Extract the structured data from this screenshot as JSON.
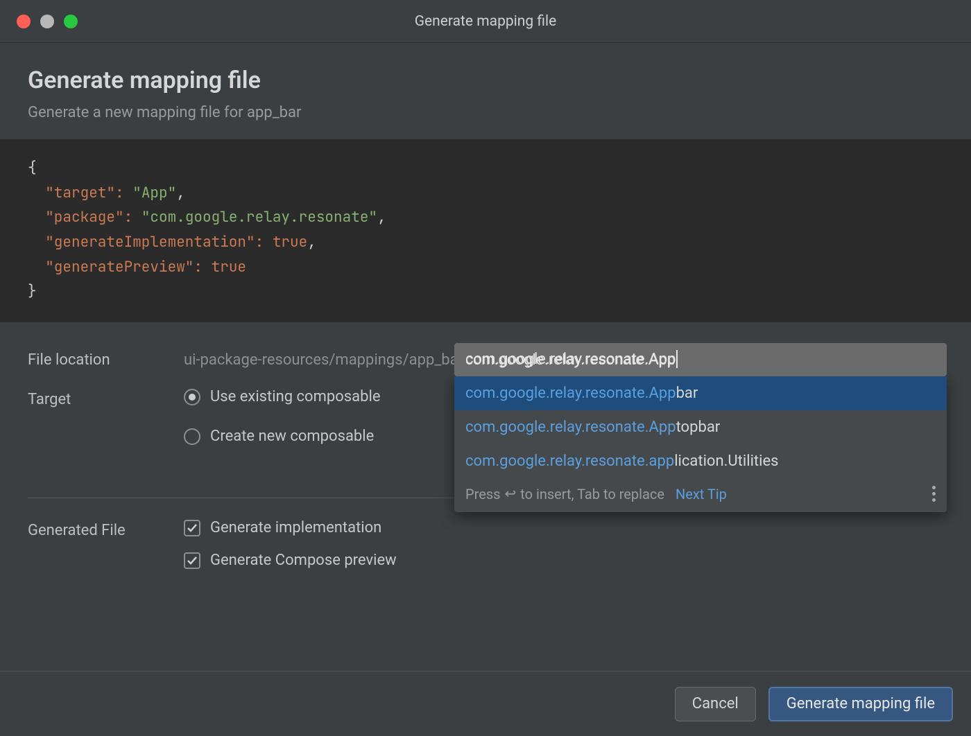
{
  "window": {
    "title": "Generate mapping file"
  },
  "header": {
    "title": "Generate mapping file",
    "subtitle": "Generate a new mapping file for app_bar"
  },
  "code_preview": {
    "target_key": "\"target\"",
    "target_val": "\"App\"",
    "package_key": "\"package\"",
    "package_val": "\"com.google.relay.resonate\"",
    "genimpl_key": "\"generateImplementation\"",
    "genimpl_val": "true",
    "genprev_key": "\"generatePreview\"",
    "genprev_val": "true"
  },
  "form": {
    "file_location_label": "File location",
    "file_location_value": "ui-package-resources/mappings/app_bar.json",
    "target_label": "Target",
    "radio_existing": "Use existing composable",
    "radio_create": "Create new composable",
    "target_input_value": "com.google.relay.resonate.App",
    "generated_file_label": "Generated File",
    "checkbox_impl": "Generate implementation",
    "checkbox_preview": "Generate Compose preview"
  },
  "autocomplete": {
    "items": [
      {
        "match": "com.google.relay.resonate.App",
        "rest": "bar"
      },
      {
        "match": "com.google.relay.resonate.App",
        "rest": "topbar"
      },
      {
        "match": "com.google.relay.resonate.app",
        "rest": "lication.Utilities"
      }
    ],
    "hint_prefix": "Press ",
    "hint_mid": " to insert, Tab to replace",
    "next_tip": "Next Tip"
  },
  "footer": {
    "cancel": "Cancel",
    "confirm": "Generate mapping file"
  }
}
